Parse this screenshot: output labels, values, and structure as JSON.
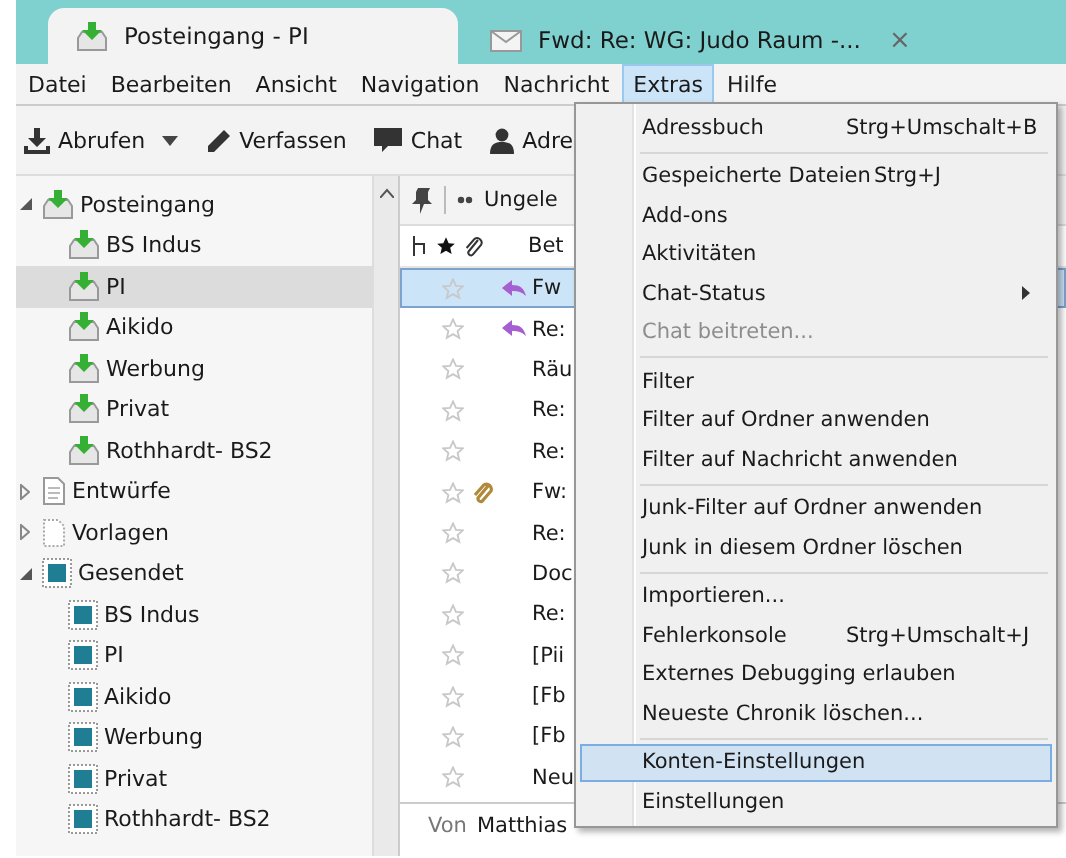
{
  "tabs": [
    {
      "label": "Posteingang - PI",
      "kind": "inbox",
      "selected": true,
      "closable": false
    },
    {
      "label": "Fwd: Re: WG: Judo Raum -...",
      "kind": "mail",
      "selected": false,
      "closable": true,
      "close": "×"
    }
  ],
  "menubar": [
    {
      "label": "Datei",
      "selected": false
    },
    {
      "label": "Bearbeiten",
      "selected": false
    },
    {
      "label": "Ansicht",
      "selected": false
    },
    {
      "label": "Navigation",
      "selected": false
    },
    {
      "label": "Nachricht",
      "selected": false
    },
    {
      "label": "Extras",
      "selected": true
    },
    {
      "label": "Hilfe",
      "selected": false
    }
  ],
  "toolbar": [
    {
      "label": "Abrufen",
      "kind": "get",
      "dropdown": true
    },
    {
      "label": "Verfassen",
      "kind": "write",
      "dropdown": false
    },
    {
      "label": "Chat",
      "kind": "chat",
      "dropdown": false
    },
    {
      "label": "Adre",
      "kind": "contact",
      "dropdown": false
    }
  ],
  "folders": [
    {
      "label": "Posteingang",
      "kind": "inbox",
      "expanded": true,
      "selected": false,
      "children": [
        {
          "label": "BS Indus",
          "kind": "inbox",
          "selected": false
        },
        {
          "label": "PI",
          "kind": "inbox",
          "selected": true
        },
        {
          "label": "Aikido",
          "kind": "inbox",
          "selected": false
        },
        {
          "label": "Werbung",
          "kind": "inbox",
          "selected": false
        },
        {
          "label": "Privat",
          "kind": "inbox",
          "selected": false
        },
        {
          "label": "Rothhardt- BS2",
          "kind": "inbox",
          "selected": false
        }
      ]
    },
    {
      "label": "Entwürfe",
      "kind": "drafts",
      "expanded": false,
      "selected": false
    },
    {
      "label": "Vorlagen",
      "kind": "templates",
      "expanded": false,
      "selected": false
    },
    {
      "label": "Gesendet",
      "kind": "sent",
      "expanded": true,
      "selected": false,
      "children": [
        {
          "label": "BS Indus",
          "kind": "sent",
          "selected": false
        },
        {
          "label": "PI",
          "kind": "sent",
          "selected": false
        },
        {
          "label": "Aikido",
          "kind": "sent",
          "selected": false
        },
        {
          "label": "Werbung",
          "kind": "sent",
          "selected": false
        },
        {
          "label": "Privat",
          "kind": "sent",
          "selected": false
        },
        {
          "label": "Rothhardt- BS2",
          "kind": "sent",
          "selected": false
        }
      ]
    }
  ],
  "filter_bar": {
    "label": "Ungele"
  },
  "message_list": {
    "header": "Bet",
    "rows": [
      {
        "subject": "Fw",
        "starred": false,
        "replied": true,
        "attachment": false,
        "selected": true
      },
      {
        "subject": "Re:",
        "starred": false,
        "replied": true,
        "attachment": false,
        "selected": false
      },
      {
        "subject": "Räu",
        "starred": false,
        "replied": false,
        "attachment": false,
        "selected": false
      },
      {
        "subject": "Re:",
        "starred": false,
        "replied": false,
        "attachment": false,
        "selected": false
      },
      {
        "subject": "Re:",
        "starred": false,
        "replied": false,
        "attachment": false,
        "selected": false
      },
      {
        "subject": "Fw:",
        "starred": false,
        "replied": false,
        "attachment": true,
        "selected": false
      },
      {
        "subject": "Re:",
        "starred": false,
        "replied": false,
        "attachment": false,
        "selected": false
      },
      {
        "subject": "Doc",
        "starred": false,
        "replied": false,
        "attachment": false,
        "selected": false
      },
      {
        "subject": "Re:",
        "starred": false,
        "replied": false,
        "attachment": false,
        "selected": false
      },
      {
        "subject": "[Pii",
        "starred": false,
        "replied": false,
        "attachment": false,
        "selected": false
      },
      {
        "subject": "[Fb",
        "starred": false,
        "replied": false,
        "attachment": false,
        "selected": false
      },
      {
        "subject": "[Fb",
        "starred": false,
        "replied": false,
        "attachment": false,
        "selected": false
      },
      {
        "subject": "Neu",
        "starred": false,
        "replied": false,
        "attachment": false,
        "selected": false
      }
    ]
  },
  "preview": {
    "from_label": "Von",
    "from": "Matthias"
  },
  "menu": [
    {
      "kind": "item",
      "label": "Adressbuch",
      "shortcut": "Strg+Umschalt+B",
      "disabled": false,
      "selected": false,
      "submenu": false
    },
    {
      "kind": "separator"
    },
    {
      "kind": "item",
      "label": "Gespeicherte Dateien",
      "shortcut": "Strg+J",
      "disabled": false,
      "selected": false,
      "submenu": false
    },
    {
      "kind": "item",
      "label": "Add-ons",
      "disabled": false,
      "selected": false,
      "submenu": false
    },
    {
      "kind": "item",
      "label": "Aktivitäten",
      "disabled": false,
      "selected": false,
      "submenu": false
    },
    {
      "kind": "item",
      "label": "Chat-Status",
      "disabled": false,
      "selected": false,
      "submenu": true
    },
    {
      "kind": "item",
      "label": "Chat beitreten...",
      "disabled": true,
      "selected": false,
      "submenu": false
    },
    {
      "kind": "separator"
    },
    {
      "kind": "item",
      "label": "Filter",
      "disabled": false,
      "selected": false,
      "submenu": false
    },
    {
      "kind": "item",
      "label": "Filter auf Ordner anwenden",
      "disabled": false,
      "selected": false,
      "submenu": false
    },
    {
      "kind": "item",
      "label": "Filter auf Nachricht anwenden",
      "disabled": false,
      "selected": false,
      "submenu": false
    },
    {
      "kind": "separator"
    },
    {
      "kind": "item",
      "label": "Junk-Filter auf Ordner anwenden",
      "disabled": false,
      "selected": false,
      "submenu": false
    },
    {
      "kind": "item",
      "label": "Junk in diesem Ordner löschen",
      "disabled": false,
      "selected": false,
      "submenu": false
    },
    {
      "kind": "separator"
    },
    {
      "kind": "item",
      "label": "Importieren...",
      "disabled": false,
      "selected": false,
      "submenu": false
    },
    {
      "kind": "item",
      "label": "Fehlerkonsole",
      "shortcut": "Strg+Umschalt+J",
      "disabled": false,
      "selected": false,
      "submenu": false
    },
    {
      "kind": "item",
      "label": "Externes Debugging erlauben",
      "disabled": false,
      "selected": false,
      "submenu": false
    },
    {
      "kind": "item",
      "label": "Neueste Chronik löschen...",
      "disabled": false,
      "selected": false,
      "submenu": false
    },
    {
      "kind": "separator"
    },
    {
      "kind": "item",
      "label": "Konten-Einstellungen",
      "disabled": false,
      "selected": true,
      "submenu": false
    },
    {
      "kind": "item",
      "label": "Einstellungen",
      "disabled": false,
      "selected": false,
      "submenu": false
    }
  ]
}
